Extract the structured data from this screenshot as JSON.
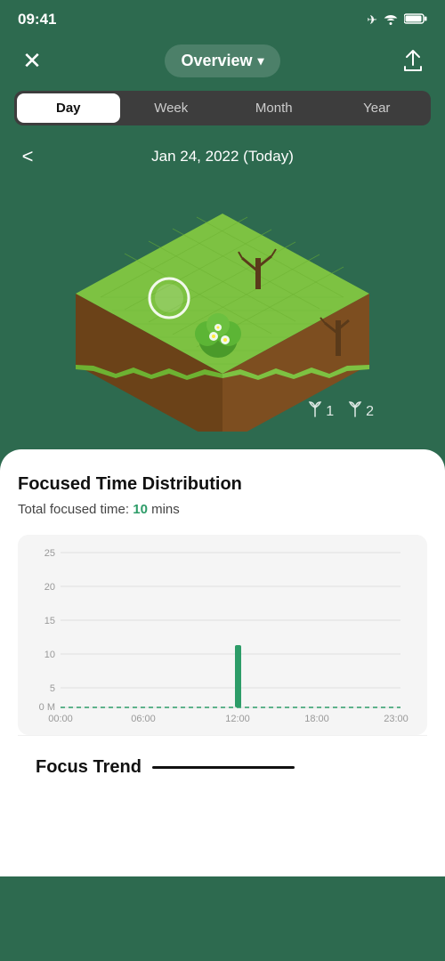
{
  "statusBar": {
    "time": "09:41",
    "icons": {
      "airplane": "✈",
      "wifi": "WiFi",
      "battery": "Battery"
    }
  },
  "navBar": {
    "closeIcon": "×",
    "title": "Overview",
    "chevron": "▾",
    "shareIcon": "⬆"
  },
  "periodSelector": {
    "options": [
      "Day",
      "Week",
      "Month",
      "Year"
    ],
    "activeIndex": 0
  },
  "dateNav": {
    "leftArrow": "<",
    "label": "Jan 24, 2022 (Today)",
    "rightArrow": ">"
  },
  "plantCounters": [
    {
      "icon": "🌱",
      "count": "1"
    },
    {
      "icon": "🌱",
      "count": "2"
    }
  ],
  "chartCard": {
    "title": "Focused Time Distribution",
    "focusedTimePrefix": "Total focused time: ",
    "focusedTimeValue": "10",
    "focusedTimeSuffix": " mins"
  },
  "chart": {
    "yLabels": [
      "25",
      "20",
      "15",
      "10",
      "5",
      "0 M"
    ],
    "xLabels": [
      "00:00",
      "06:00",
      "12:00",
      "18:00",
      "23:00"
    ],
    "barHour": 12,
    "barValue": 10,
    "maxValue": 25
  },
  "focusTrend": {
    "title": "Focus Trend"
  }
}
